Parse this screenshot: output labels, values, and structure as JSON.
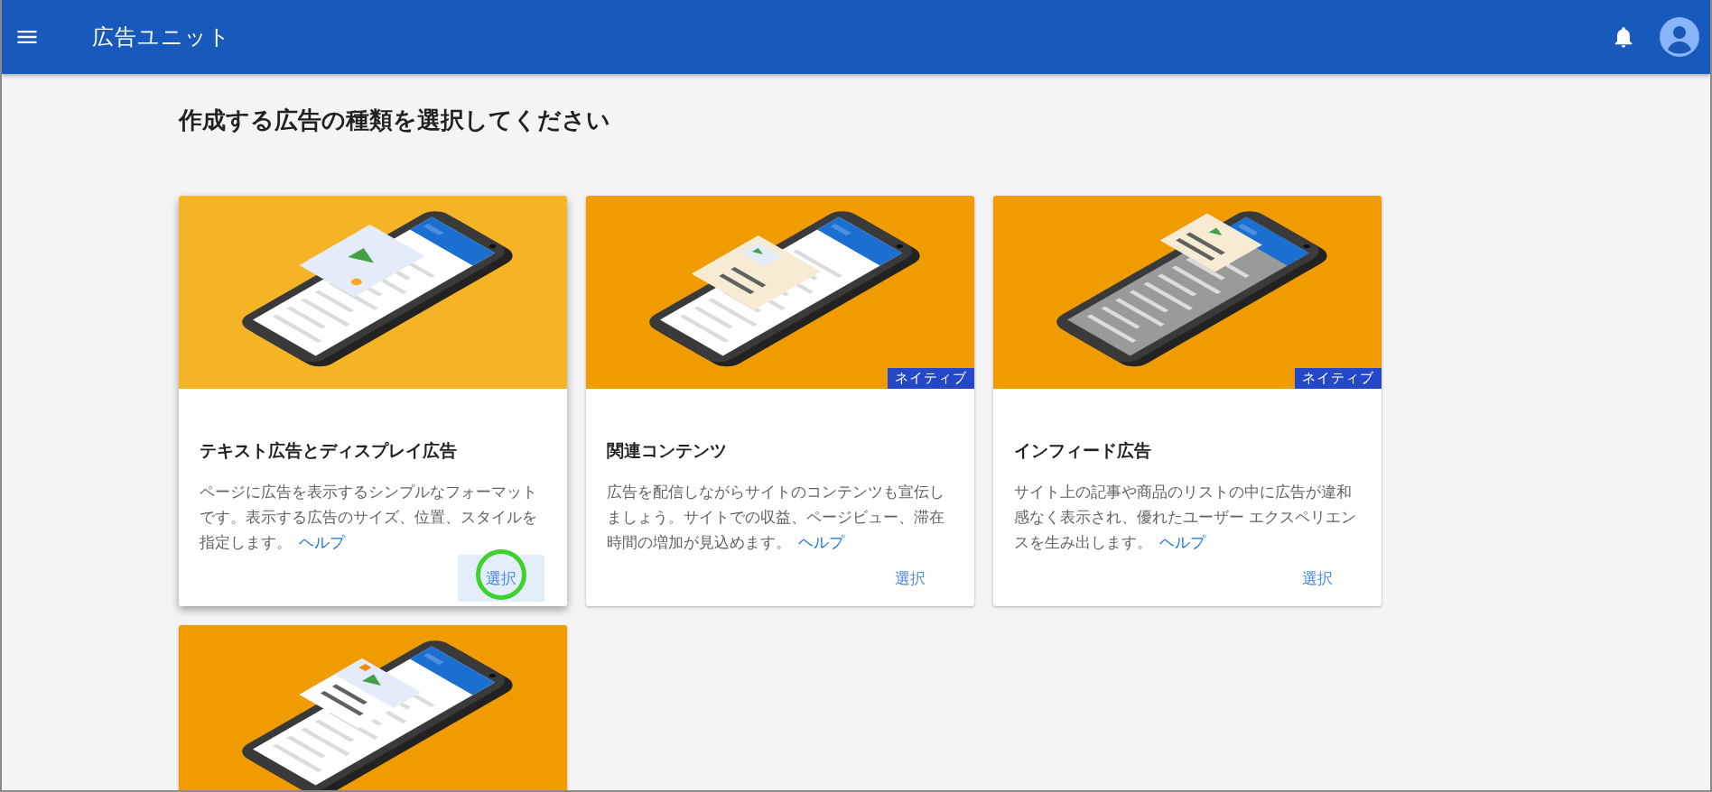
{
  "app_bar": {
    "title": "広告ユニット"
  },
  "heading": "作成する広告の種類を選択してください",
  "cards": [
    {
      "kind": "display",
      "title": "テキスト広告とディスプレイ広告",
      "description": "ページに広告を表示するシンプルなフォーマットです。表示する広告のサイズ、位置、スタイルを指定します。",
      "help_link": "ヘルプ",
      "action": {
        "label": "選択",
        "hovered": true
      }
    },
    {
      "kind": "native",
      "badge": "ネイティブ",
      "title": "関連コンテンツ",
      "description": "広告を配信しながらサイトのコンテンツも宣伝しましょう。サイトでの収益、ページビュー、滞在時間の増加が見込めます。",
      "help_link": "ヘルプ",
      "action": {
        "label": "選択",
        "hovered": false
      }
    },
    {
      "kind": "infeed",
      "badge": "ネイティブ",
      "title": "インフィード広告",
      "description": "サイト上の記事や商品のリストの中に広告が違和感なく表示され、優れたユーザー エクスペリエンスを生み出します。",
      "help_link": "ヘルプ",
      "action": {
        "label": "選択",
        "hovered": false
      }
    },
    {
      "kind": "mixed"
    }
  ]
}
